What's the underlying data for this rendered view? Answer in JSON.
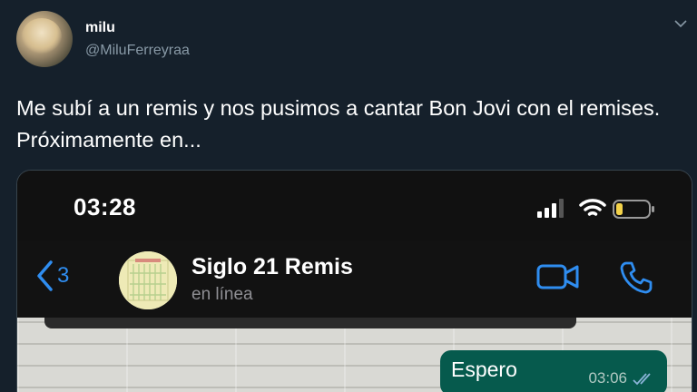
{
  "tweet": {
    "display_name": "milu",
    "handle": "@MiluFerreyraa",
    "text": "Me subí a un remis y nos pusimos a cantar Bon Jovi con el remises. Próximamente en..."
  },
  "phone": {
    "time": "03:28",
    "back_count": "3",
    "contact_name": "Siglo 21 Remis",
    "contact_status": "en línea",
    "message": {
      "text": "Espero",
      "time": "03:06"
    }
  },
  "colors": {
    "background": "#15202b",
    "accent_blue": "#2f8df0",
    "bubble_green": "#065a4d",
    "battery_yellow": "#f3d24a"
  },
  "icons": [
    "caret-down-icon",
    "signal-icon",
    "wifi-icon",
    "battery-icon",
    "back-chevron-icon",
    "video-camera-icon",
    "phone-icon",
    "double-check-icon"
  ]
}
